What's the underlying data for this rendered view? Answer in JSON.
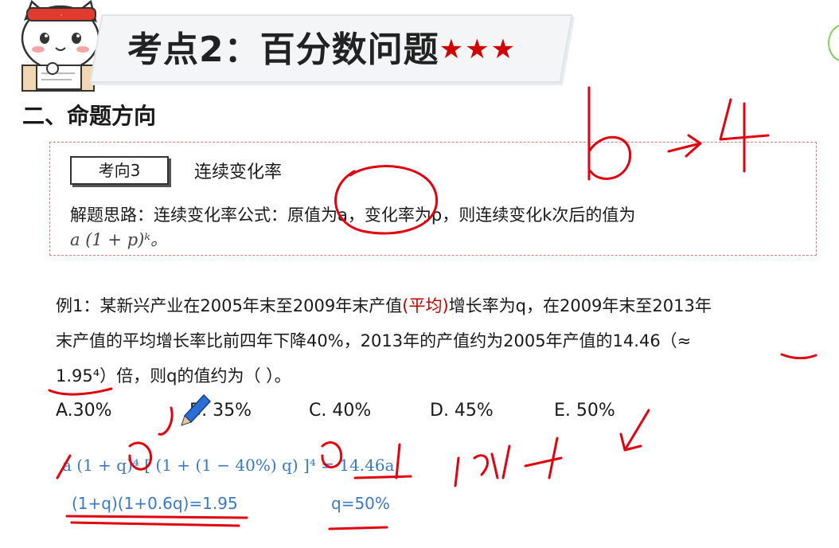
{
  "header": {
    "title": "考点2：百分数问题",
    "stars": "★★★"
  },
  "section": {
    "heading": "二、命题方向"
  },
  "method": {
    "badge": "考向3",
    "name": "连续变化率",
    "line1": "解题思路：连续变化率公式：原值为a，变化率为p，则连续变化k次后的值为",
    "line2": "a (1 + p)ᵏ。"
  },
  "example": {
    "line1_a": "例1：某新兴产业在2005年末至2009年末产值",
    "line1_red": "(平均)",
    "line1_b": "增长率为q，在2009年末至2013年",
    "line2": "末产值的平均增长率比前四年下降40%，2013年的产值约为2005年产值的14.46（≈",
    "line3": "1.95⁴）倍，则q的值约为（   ）。",
    "options": {
      "A": "A.30%",
      "B": "B. 35%",
      "C": "C. 40%",
      "D": "D. 45%",
      "E": "E. 50%"
    }
  },
  "solution": {
    "line1": "a (1 + q)⁴ [ (1 + (1 − 40%) q) ]⁴ = 14.46a",
    "line2": "(1+q)(1+0.6q)=1.95",
    "line3": "q=50%"
  },
  "annotations": {
    "ink_color": "#e0000f",
    "handwritten": "1.9…4"
  }
}
